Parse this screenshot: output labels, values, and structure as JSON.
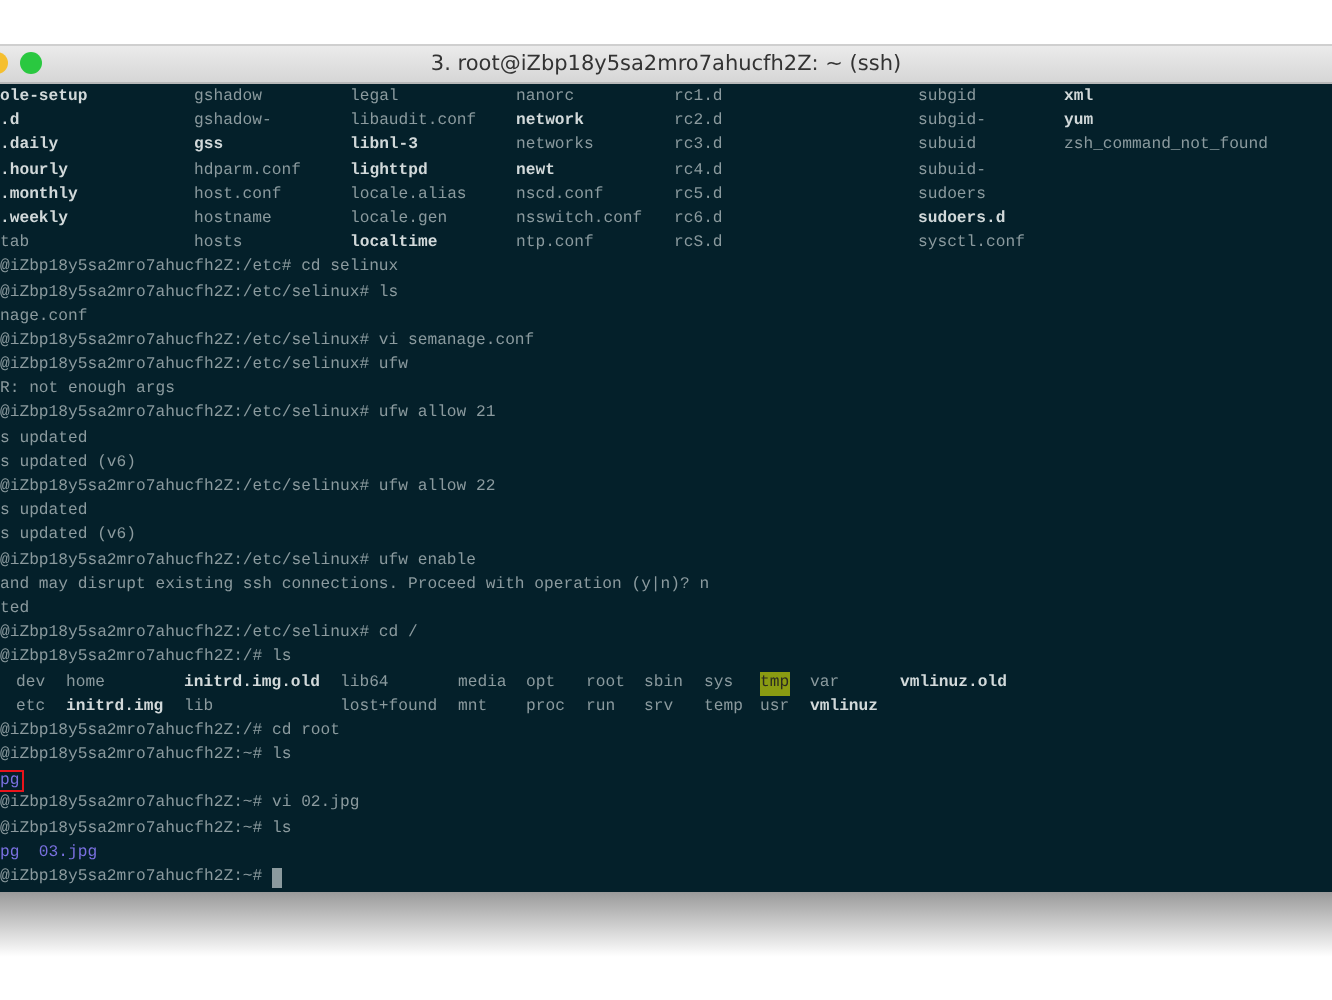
{
  "window": {
    "title": "3. root@iZbp18y5sa2mro7ahucfh2Z: ~ (ssh)"
  },
  "lines": [
    {
      "kind": "etc-columns",
      "cells": [
        {
          "text": "ole-setup",
          "bold": true
        },
        {
          "text": "gshadow",
          "bold": false
        },
        {
          "text": "legal",
          "bold": false
        },
        {
          "text": "nanorc",
          "bold": false
        },
        {
          "text": "rc1.d",
          "bold": false
        },
        {
          "text": "subgid",
          "bold": false
        },
        {
          "text": "xml",
          "bold": true
        }
      ]
    },
    {
      "kind": "etc-columns",
      "cells": [
        {
          "text": ".d",
          "bold": true
        },
        {
          "text": "gshadow-",
          "bold": false
        },
        {
          "text": "libaudit.conf",
          "bold": false
        },
        {
          "text": "network",
          "bold": true
        },
        {
          "text": "rc2.d",
          "bold": false
        },
        {
          "text": "subgid-",
          "bold": false
        },
        {
          "text": "yum",
          "bold": true
        }
      ]
    },
    {
      "kind": "etc-columns",
      "cells": [
        {
          "text": ".daily",
          "bold": true
        },
        {
          "text": "gss",
          "bold": true
        },
        {
          "text": "libnl-3",
          "bold": true
        },
        {
          "text": "networks",
          "bold": false
        },
        {
          "text": "rc3.d",
          "bold": false
        },
        {
          "text": "subuid",
          "bold": false
        },
        {
          "text": "zsh_command_not_found",
          "bold": false
        }
      ]
    },
    {
      "kind": "etc-columns",
      "cells": [
        {
          "text": ".hourly",
          "bold": true
        },
        {
          "text": "hdparm.conf",
          "bold": false
        },
        {
          "text": "lighttpd",
          "bold": true
        },
        {
          "text": "newt",
          "bold": true
        },
        {
          "text": "rc4.d",
          "bold": false
        },
        {
          "text": "subuid-",
          "bold": false
        }
      ]
    },
    {
      "kind": "etc-columns",
      "cells": [
        {
          "text": ".monthly",
          "bold": true
        },
        {
          "text": "host.conf",
          "bold": false
        },
        {
          "text": "locale.alias",
          "bold": false
        },
        {
          "text": "nscd.conf",
          "bold": false
        },
        {
          "text": "rc5.d",
          "bold": false
        },
        {
          "text": "sudoers",
          "bold": false
        }
      ]
    },
    {
      "kind": "etc-columns",
      "cells": [
        {
          "text": ".weekly",
          "bold": true
        },
        {
          "text": "hostname",
          "bold": false
        },
        {
          "text": "locale.gen",
          "bold": false
        },
        {
          "text": "nsswitch.conf",
          "bold": false
        },
        {
          "text": "rc6.d",
          "bold": false
        },
        {
          "text": "sudoers.d",
          "bold": true
        }
      ]
    },
    {
      "kind": "etc-columns",
      "cells": [
        {
          "text": "tab",
          "bold": false
        },
        {
          "text": "hosts",
          "bold": false
        },
        {
          "text": "localtime",
          "bold": true
        },
        {
          "text": "ntp.conf",
          "bold": false
        },
        {
          "text": "rcS.d",
          "bold": false
        },
        {
          "text": "sysctl.conf",
          "bold": false
        }
      ]
    },
    {
      "kind": "text",
      "text": "@iZbp18y5sa2mro7ahucfh2Z:/etc# cd selinux"
    },
    {
      "kind": "text",
      "text": "@iZbp18y5sa2mro7ahucfh2Z:/etc/selinux# ls"
    },
    {
      "kind": "text",
      "text": "nage.conf"
    },
    {
      "kind": "text",
      "text": "@iZbp18y5sa2mro7ahucfh2Z:/etc/selinux# vi semanage.conf"
    },
    {
      "kind": "text",
      "text": "@iZbp18y5sa2mro7ahucfh2Z:/etc/selinux# ufw"
    },
    {
      "kind": "text",
      "text": "R: not enough args"
    },
    {
      "kind": "text",
      "text": "@iZbp18y5sa2mro7ahucfh2Z:/etc/selinux# ufw allow 21"
    },
    {
      "kind": "text",
      "text": "s updated"
    },
    {
      "kind": "text",
      "text": "s updated (v6)"
    },
    {
      "kind": "text",
      "text": "@iZbp18y5sa2mro7ahucfh2Z:/etc/selinux# ufw allow 22"
    },
    {
      "kind": "text",
      "text": "s updated"
    },
    {
      "kind": "text",
      "text": "s updated (v6)"
    },
    {
      "kind": "text",
      "text": "@iZbp18y5sa2mro7ahucfh2Z:/etc/selinux# ufw enable"
    },
    {
      "kind": "text",
      "text": "and may disrupt existing ssh connections. Proceed with operation (y|n)? n"
    },
    {
      "kind": "text",
      "text": "ted"
    },
    {
      "kind": "text",
      "text": "@iZbp18y5sa2mro7ahucfh2Z:/etc/selinux# cd /"
    },
    {
      "kind": "text",
      "text": "@iZbp18y5sa2mro7ahucfh2Z:/# ls"
    },
    {
      "kind": "root-columns",
      "cells": [
        {
          "text": "dev",
          "bold": false
        },
        {
          "text": "home",
          "bold": false
        },
        {
          "text": "initrd.img.old",
          "bold": true
        },
        {
          "text": "lib64",
          "bold": false
        },
        {
          "text": "media",
          "bold": false
        },
        {
          "text": "opt",
          "bold": false
        },
        {
          "text": "root",
          "bold": false
        },
        {
          "text": "sbin",
          "bold": false
        },
        {
          "text": "sys",
          "bold": false
        },
        {
          "text": "tmp",
          "bold": false,
          "highlighted": true
        },
        {
          "text": "var",
          "bold": false
        },
        {
          "text": "vmlinuz.old",
          "bold": true
        }
      ]
    },
    {
      "kind": "root-columns",
      "cells": [
        {
          "text": "etc",
          "bold": false
        },
        {
          "text": "initrd.img",
          "bold": true
        },
        {
          "text": "lib",
          "bold": false
        },
        {
          "text": "lost+found",
          "bold": false
        },
        {
          "text": "mnt",
          "bold": false
        },
        {
          "text": "proc",
          "bold": false
        },
        {
          "text": "run",
          "bold": false
        },
        {
          "text": "srv",
          "bold": false
        },
        {
          "text": "temp",
          "bold": false
        },
        {
          "text": "usr",
          "bold": false
        },
        {
          "text": "vmlinuz",
          "bold": true
        }
      ]
    },
    {
      "kind": "text",
      "text": "@iZbp18y5sa2mro7ahucfh2Z:/# cd root"
    },
    {
      "kind": "text",
      "text": "@iZbp18y5sa2mro7ahucfh2Z:~# ls"
    },
    {
      "kind": "image-files",
      "text": "pg",
      "outlined": true
    },
    {
      "kind": "text",
      "text": "@iZbp18y5sa2mro7ahucfh2Z:~# vi 02.jpg"
    },
    {
      "kind": "text",
      "text": "@iZbp18y5sa2mro7ahucfh2Z:~# ls"
    },
    {
      "kind": "image-files",
      "text": "pg  03.jpg",
      "outlined": false
    },
    {
      "kind": "text",
      "text": "@iZbp18y5sa2mro7ahucfh2Z:~#",
      "cursor": true
    }
  ]
}
